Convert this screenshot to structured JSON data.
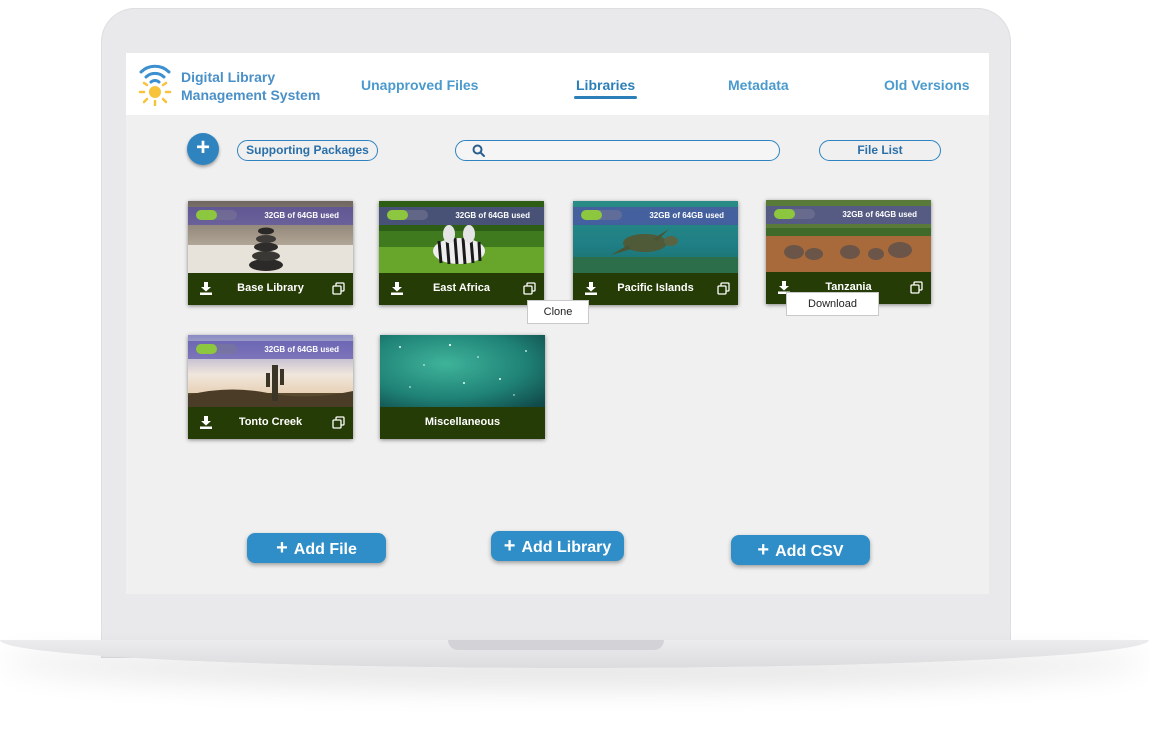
{
  "brand": {
    "line1": "Digital Library",
    "line2": "Management System"
  },
  "nav": [
    {
      "label": "Unapproved Files",
      "active": false
    },
    {
      "label": "Libraries",
      "active": true
    },
    {
      "label": "Metadata",
      "active": false
    },
    {
      "label": "Old Versions",
      "active": false
    }
  ],
  "toolbar": {
    "add_icon": "plus-icon",
    "supporting_packages": "Supporting Packages",
    "search_placeholder": "",
    "file_list": "File List"
  },
  "libraries": [
    {
      "name": "Base Library",
      "usage": "32GB of  64GB used",
      "used_fraction": 0.5,
      "image": "stones"
    },
    {
      "name": "East Africa",
      "usage": "32GB of  64GB used",
      "used_fraction": 0.5,
      "image": "zebras"
    },
    {
      "name": "Pacific Islands",
      "usage": "32GB of  64GB used",
      "used_fraction": 0.5,
      "image": "turtle"
    },
    {
      "name": "Tanzania",
      "usage": "32GB of  64GB used",
      "used_fraction": 0.5,
      "image": "elephants"
    },
    {
      "name": "Tonto Creek",
      "usage": "32GB of  64GB used",
      "used_fraction": 0.5,
      "image": "cactus"
    },
    {
      "name": "Miscellaneous",
      "image": "space"
    }
  ],
  "tooltips": {
    "clone": "Clone",
    "download": "Download"
  },
  "actions": {
    "add_file": "Add File",
    "add_library": "Add Library",
    "add_csv": "Add CSV",
    "plus": "+"
  },
  "colors": {
    "accent": "#2f84c0",
    "card_footer": "#263c06",
    "usage_fill": "#8dc63f",
    "usage_bar": "#5a4fb0"
  }
}
